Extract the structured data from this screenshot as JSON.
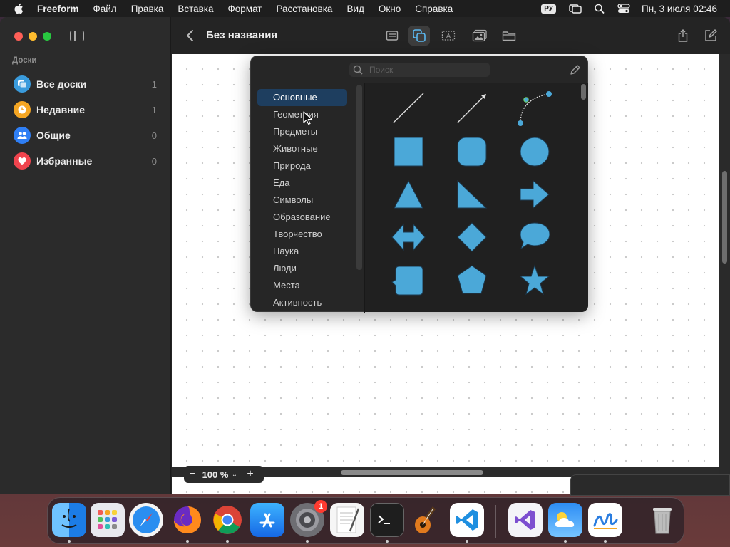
{
  "menubar": {
    "app_name": "Freeform",
    "items": [
      "Файл",
      "Правка",
      "Вставка",
      "Формат",
      "Расстановка",
      "Вид",
      "Окно",
      "Справка"
    ],
    "input_source": "РУ",
    "clock": "Пн, 3 июля  02:46"
  },
  "sidebar": {
    "section_title": "Доски",
    "items": [
      {
        "label": "Все доски",
        "count": "1",
        "icon": "boards-icon",
        "color": "#3a9bdc"
      },
      {
        "label": "Недавние",
        "count": "1",
        "icon": "clock-icon",
        "color": "#f5a623"
      },
      {
        "label": "Общие",
        "count": "0",
        "icon": "people-icon",
        "color": "#2f7ff5"
      },
      {
        "label": "Избранные",
        "count": "0",
        "icon": "heart-icon",
        "color": "#f0444e"
      }
    ]
  },
  "toolbar": {
    "title": "Без названия"
  },
  "shape_picker": {
    "search_placeholder": "Поиск",
    "categories": [
      "Основные",
      "Геометрия",
      "Предметы",
      "Животные",
      "Природа",
      "Еда",
      "Символы",
      "Образование",
      "Творчество",
      "Наука",
      "Люди",
      "Места",
      "Активность"
    ],
    "selected_category": "Основные",
    "shapes": [
      "line",
      "arrow-line",
      "curve",
      "square",
      "rounded-square",
      "circle",
      "triangle",
      "right-triangle",
      "arrow",
      "double-arrow",
      "diamond",
      "speech-bubble",
      "callout-square",
      "pentagon",
      "star"
    ],
    "shape_color": "#4ba8d8"
  },
  "zoom": {
    "minus": "−",
    "value": "100 %",
    "plus": "+"
  },
  "dock": {
    "apps": [
      "Finder",
      "Launchpad",
      "Safari",
      "Firefox",
      "Chrome",
      "App Store",
      "System Settings",
      "TextEdit",
      "Terminal",
      "GarageBand",
      "Visual Studio Code",
      "Visual Studio",
      "Weather",
      "Freeform",
      "Trash"
    ],
    "settings_badge": "1"
  }
}
